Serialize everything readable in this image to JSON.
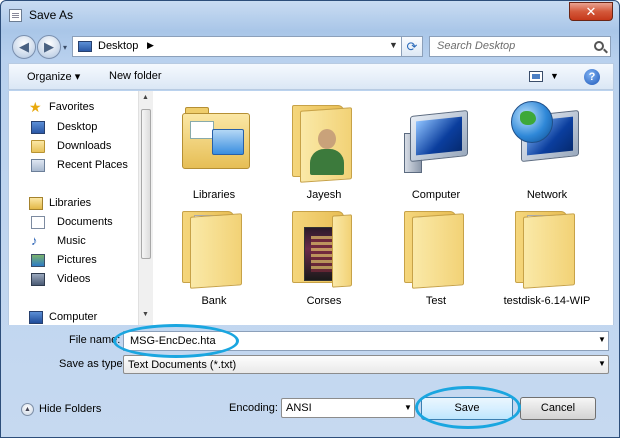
{
  "window": {
    "title": "Save As",
    "close_label": "✕"
  },
  "nav": {
    "back_glyph": "◀",
    "forward_glyph": "▶",
    "address": "Desktop",
    "search_placeholder": "Search Desktop"
  },
  "toolbar": {
    "organize": "Organize ▾",
    "new_folder": "New folder",
    "help": "?"
  },
  "sidebar": {
    "items": [
      {
        "label": "Favorites",
        "icon": "favorites-star-icon"
      },
      {
        "label": "Desktop",
        "icon": "desktop-icon"
      },
      {
        "label": "Downloads",
        "icon": "downloads-folder-icon"
      },
      {
        "label": "Recent Places",
        "icon": "recent-places-icon"
      },
      {
        "label": "Libraries",
        "icon": "libraries-icon"
      },
      {
        "label": "Documents",
        "icon": "documents-icon"
      },
      {
        "label": "Music",
        "icon": "music-icon"
      },
      {
        "label": "Pictures",
        "icon": "pictures-icon"
      },
      {
        "label": "Videos",
        "icon": "videos-icon"
      },
      {
        "label": "Computer",
        "icon": "computer-icon"
      }
    ]
  },
  "files": [
    {
      "label": "Libraries",
      "icon": "libraries-folder-icon"
    },
    {
      "label": "Jayesh",
      "icon": "user-folder-icon"
    },
    {
      "label": "Computer",
      "icon": "computer-icon"
    },
    {
      "label": "Network",
      "icon": "network-icon"
    },
    {
      "label": "Bank",
      "icon": "folder-icon"
    },
    {
      "label": "Corses",
      "icon": "folder-icon"
    },
    {
      "label": "Test",
      "icon": "folder-icon"
    },
    {
      "label": "testdisk-6.14-WIP",
      "icon": "folder-icon"
    }
  ],
  "form": {
    "file_name_label": "File name:",
    "file_name_value": "MSG-EncDec.hta",
    "save_as_type_label": "Save as type:",
    "save_as_type_value": "Text Documents (*.txt)",
    "encoding_label": "Encoding:",
    "encoding_value": "ANSI"
  },
  "footer": {
    "hide_folders": "Hide Folders",
    "save": "Save",
    "cancel": "Cancel"
  },
  "colors": {
    "highlight_ellipse": "#1aa6e0"
  }
}
